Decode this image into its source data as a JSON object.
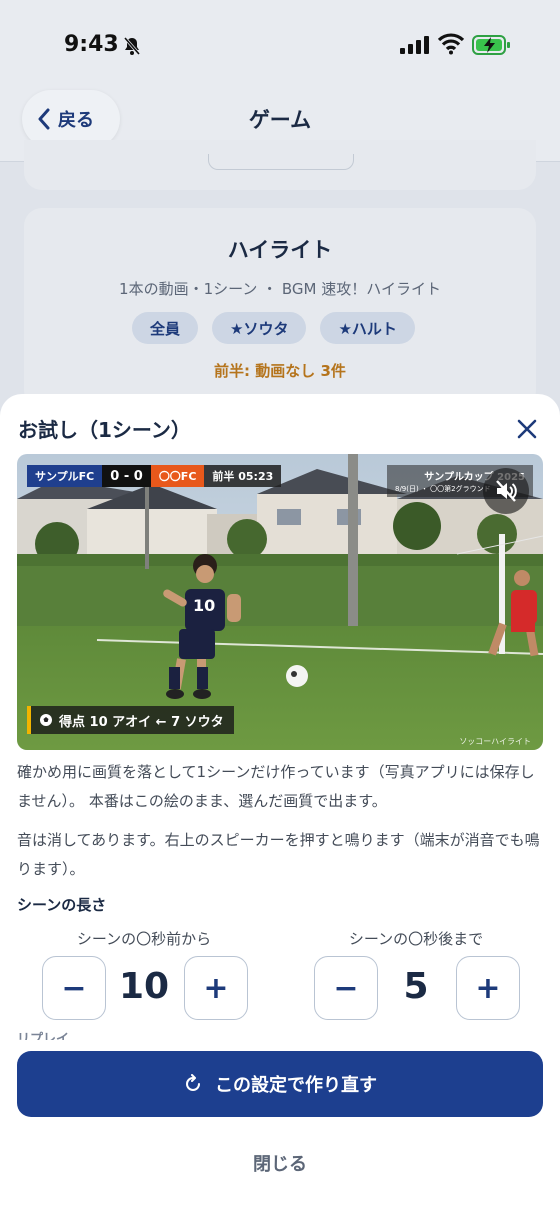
{
  "status_bar": {
    "time": "9:43"
  },
  "nav": {
    "back_label": "戻る",
    "title": "ゲーム"
  },
  "card": {
    "title": "ハイライト",
    "subtitle": "1本の動画・1シーン ・ BGM 速攻！ハイライト",
    "chips": [
      "全員",
      "★ソウタ",
      "★ハルト"
    ],
    "warning": "前半: 動画なし 3件"
  },
  "sheet": {
    "title": "お試し（1シーン）",
    "video": {
      "team_home": "サンプルFC",
      "score": "0 - 0",
      "team_away": "〇〇FC",
      "clock": "前半 05:23",
      "cup_title": "サンプルカップ 2025",
      "cup_detail": "8/9(日) ・ 〇〇第2グラウンド",
      "goal_text": "得点 10 アオイ ← 7 ソウタ",
      "watermark": "ソッコーハイライト",
      "jersey_number": "10"
    },
    "description_1": "確かめ用に画質を落として1シーンだけ作っています（写真アプリには保存しません）。 本番はこの絵のまま、選んだ画質で出ます。",
    "description_2": "音は消してあります。右上のスピーカーを押すと鳴ります（端末が消音でも鳴ります）。",
    "section_label": "シーンの長さ",
    "before": {
      "label": "シーンの〇秒前から",
      "value": "10",
      "minus": "−",
      "plus": "+"
    },
    "after": {
      "label": "シーンの〇秒後まで",
      "value": "5",
      "minus": "−",
      "plus": "+"
    },
    "cut_label": "リプレイ",
    "primary_button": "この設定で作り直す",
    "close_button": "閉じる"
  },
  "colors": {
    "accent": "#1d3f8f",
    "warning": "#b5741c",
    "away_team": "#e8581b"
  }
}
